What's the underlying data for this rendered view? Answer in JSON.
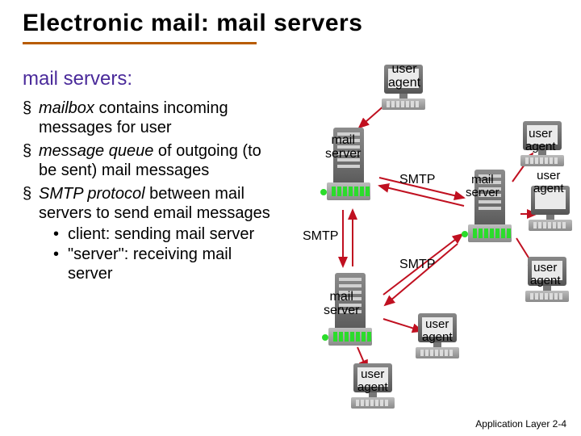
{
  "title": "Electronic mail: mail servers",
  "subheading": "mail servers:",
  "bullets": {
    "b1_part1": "mailbox",
    "b1_part2": " contains incoming messages for user",
    "b2_part1": "message queue",
    "b2_part2": " of outgoing (to be sent) mail messages",
    "b3_part1": "SMTP protocol",
    "b3_part2": " between mail servers to send email messages",
    "b3_sub1": "client: sending mail server",
    "b3_sub2": "\"server\": receiving mail server"
  },
  "labels": {
    "user_agent": "user\nagent",
    "mail_server": "mail\nserver",
    "smtp": "SMTP"
  },
  "footer": "Application Layer 2-4"
}
